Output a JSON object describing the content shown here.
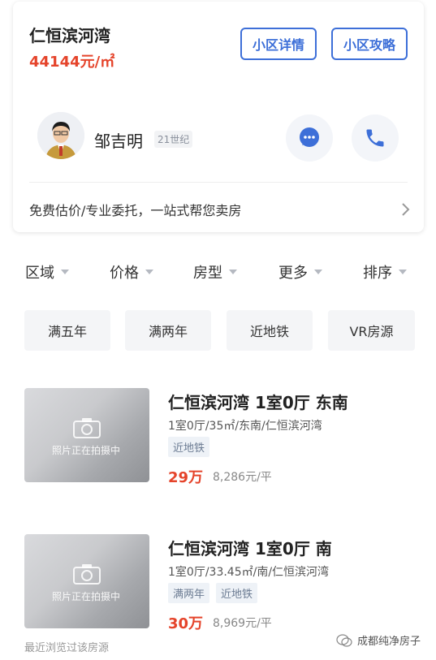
{
  "estate": {
    "name": "仁恒滨河湾",
    "price": "44144元/㎡",
    "detail_button": "小区详情",
    "guide_button": "小区攻略"
  },
  "agent": {
    "name": "邹吉明",
    "company": "21世纪",
    "chat_icon": "chat-bubble-icon",
    "call_icon": "phone-icon"
  },
  "sell_banner": {
    "text": "免费估价/专业委托，一站式帮您卖房"
  },
  "filters": [
    {
      "label": "区域"
    },
    {
      "label": "价格"
    },
    {
      "label": "房型"
    },
    {
      "label": "更多"
    },
    {
      "label": "排序"
    }
  ],
  "quick_tags": [
    {
      "label": "满五年"
    },
    {
      "label": "满两年"
    },
    {
      "label": "近地铁"
    },
    {
      "label": "VR房源"
    }
  ],
  "listings": [
    {
      "title": "仁恒滨河湾 1室0厅 东南",
      "sub": "1室0厅/35㎡/东南/仁恒滨河湾",
      "tags": [
        "近地铁"
      ],
      "price": "29万",
      "unit_price": "8,286元/平",
      "thumb_caption": "照片正在拍摄中"
    },
    {
      "title": "仁恒滨河湾 1室0厅 南",
      "sub": "1室0厅/33.45㎡/南/仁恒滨河湾",
      "tags": [
        "满两年",
        "近地铁"
      ],
      "price": "30万",
      "unit_price": "8,969元/平",
      "thumb_caption": "照片正在拍摄中"
    }
  ],
  "recent_note": "最近浏览过该房源",
  "watermark": "成都纯净房子",
  "colors": {
    "accent_blue": "#3d6fd8",
    "price_red": "#e5442b",
    "tag_bg": "#eef2f7"
  }
}
